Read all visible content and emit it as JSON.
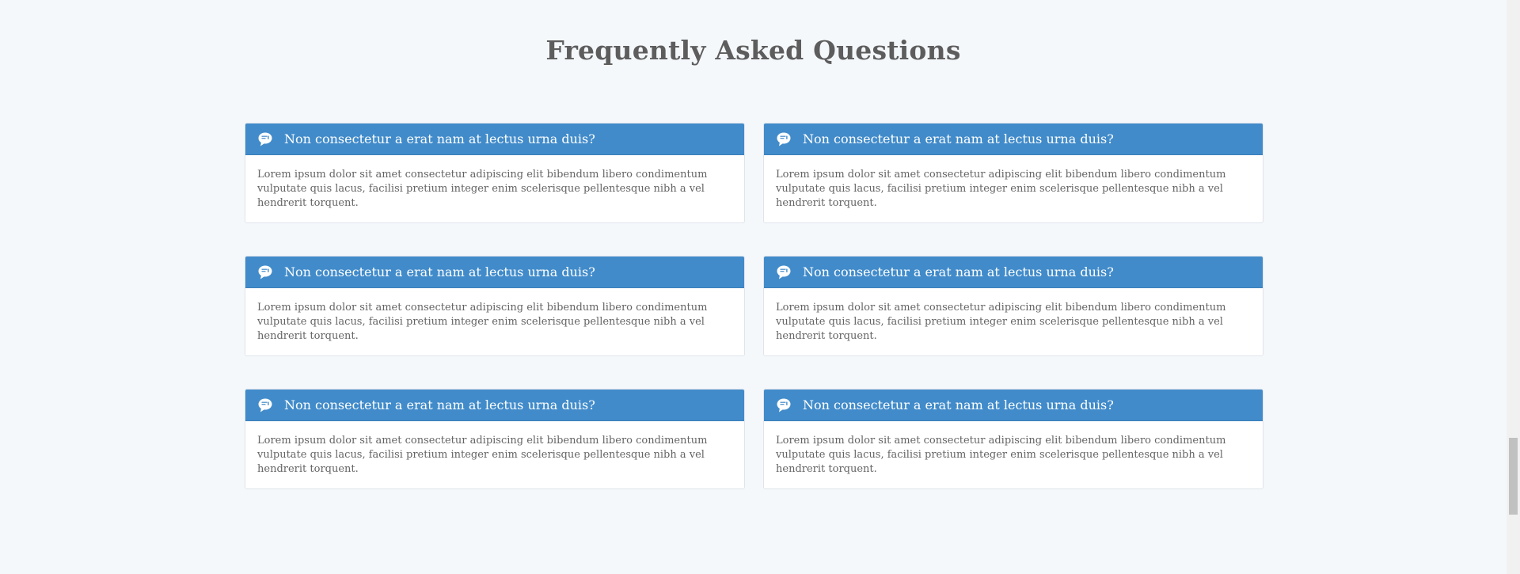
{
  "section": {
    "title": "Frequently Asked Questions"
  },
  "faq": {
    "icon": "speech-bubble-icon",
    "items": [
      {
        "question": "Non consectetur a erat nam at lectus urna duis?",
        "answer": "Lorem ipsum dolor sit amet consectetur adipiscing elit bibendum libero condimentum vulputate quis lacus, facilisi pretium integer enim scelerisque pellentesque nibh a vel hendrerit torquent."
      },
      {
        "question": "Non consectetur a erat nam at lectus urna duis?",
        "answer": "Lorem ipsum dolor sit amet consectetur adipiscing elit bibendum libero condimentum vulputate quis lacus, facilisi pretium integer enim scelerisque pellentesque nibh a vel hendrerit torquent."
      },
      {
        "question": "Non consectetur a erat nam at lectus urna duis?",
        "answer": "Lorem ipsum dolor sit amet consectetur adipiscing elit bibendum libero condimentum vulputate quis lacus, facilisi pretium integer enim scelerisque pellentesque nibh a vel hendrerit torquent."
      },
      {
        "question": "Non consectetur a erat nam at lectus urna duis?",
        "answer": "Lorem ipsum dolor sit amet consectetur adipiscing elit bibendum libero condimentum vulputate quis lacus, facilisi pretium integer enim scelerisque pellentesque nibh a vel hendrerit torquent."
      },
      {
        "question": "Non consectetur a erat nam at lectus urna duis?",
        "answer": "Lorem ipsum dolor sit amet consectetur adipiscing elit bibendum libero condimentum vulputate quis lacus, facilisi pretium integer enim scelerisque pellentesque nibh a vel hendrerit torquent."
      },
      {
        "question": "Non consectetur a erat nam at lectus urna duis?",
        "answer": "Lorem ipsum dolor sit amet consectetur adipiscing elit bibendum libero condimentum vulputate quis lacus, facilisi pretium integer enim scelerisque pellentesque nibh a vel hendrerit torquent."
      }
    ]
  },
  "colors": {
    "background": "#f5f8fb",
    "header_blue": "#418bca",
    "title_text": "#5d5d5d",
    "body_text": "#646464"
  }
}
